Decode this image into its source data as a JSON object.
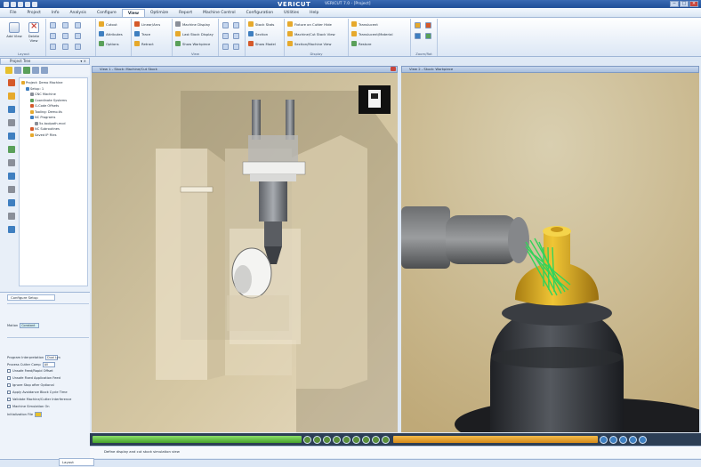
{
  "window": {
    "brand": "VERICUT",
    "document_title": "VERICUT 7.0 - [Project]",
    "quick_access_icons": [
      "new-icon",
      "open-icon",
      "save-icon",
      "undo-icon",
      "redo-icon"
    ],
    "controls": [
      "−",
      "□",
      "×"
    ]
  },
  "menu": {
    "tabs": [
      "File",
      "Project",
      "Info",
      "Analysis",
      "Configure",
      "View",
      "Optimize",
      "Report",
      "Machine Control",
      "Configuration",
      "Utilities",
      "Help"
    ],
    "active_tab": "View"
  },
  "ribbon": {
    "big_buttons": [
      {
        "label": "Add View",
        "icon": "add-view-icon"
      },
      {
        "label": "Delete View",
        "icon": "delete-view-icon"
      }
    ],
    "group_views_label": "Layout",
    "toggles_group": [
      "Cutout",
      "Attributes",
      "Options"
    ],
    "display_group": [
      "Linear/Arcs",
      "Trace",
      "Retract"
    ],
    "machine_group": [
      "Machine Display",
      "Last Stock Display",
      "Show Workpiece"
    ],
    "view_group_label": "View",
    "util_labels": [
      "Stock Stats",
      "Section",
      "Show Model"
    ],
    "clip_group": [
      "Fixture on Cutter Hide",
      "Machine/Cut Stock View",
      "Section/Machine View"
    ],
    "clip_group_label": "Display",
    "trans_group": [
      "Translucent",
      "Translucent/Material",
      "Restore"
    ],
    "trans_group_label": "Zoom/Rot",
    "color_swatches": [
      "#e6a92c",
      "#d55a2b",
      "#3f7fc0",
      "#5aa05a"
    ]
  },
  "left_panel": {
    "title": "Project Tree",
    "tree": [
      {
        "label": "Project: Demo Machine",
        "indent": 0,
        "icon": "project-icon"
      },
      {
        "label": "Setup: 1",
        "indent": 1,
        "icon": "setup-icon"
      },
      {
        "label": "CNC Machine",
        "indent": 2,
        "icon": "machine-icon"
      },
      {
        "label": "Coordinate Systems",
        "indent": 2,
        "icon": "coord-icon"
      },
      {
        "label": "G-Code Offsets",
        "indent": 2,
        "icon": "offset-icon"
      },
      {
        "label": "Tooling: Demo.tls",
        "indent": 2,
        "icon": "tooling-icon"
      },
      {
        "label": "NC Programs",
        "indent": 2,
        "icon": "nc-program-icon"
      },
      {
        "label": "5x-toolpath.mcd",
        "indent": 3,
        "icon": "file-icon"
      },
      {
        "label": "NC Subroutines",
        "indent": 2,
        "icon": "subroutine-icon"
      },
      {
        "label": "Saved IP Files",
        "indent": 2,
        "icon": "saved-icon"
      }
    ],
    "config_tab": "Configure Setup",
    "config_fields": [
      {
        "label": "Motion",
        "value": "Constant"
      }
    ],
    "config_rows": [
      {
        "label": "Program Interpretation",
        "value": "Dual Lyn",
        "type": "select"
      },
      {
        "label": "Process Cutter Comp",
        "value": "All",
        "type": "select"
      },
      {
        "label": "Unsafe Feed/Rapid Offset",
        "value": "",
        "type": "check"
      },
      {
        "label": "Unsafe Fixed Application Feed",
        "value": "",
        "type": "check"
      },
      {
        "label": "Ignore Stop after Optional",
        "value": "",
        "type": "check"
      },
      {
        "label": "Apply Avoidance Block Cycle Time",
        "value": "",
        "type": "check"
      },
      {
        "label": "Validate Machine/Cutter Interference",
        "value": "",
        "type": "check"
      },
      {
        "label": "Machine Simulation On",
        "value": "",
        "type": "check"
      },
      {
        "label": "Initialization File",
        "value": "",
        "type": "file"
      }
    ],
    "bottom_tab": "Layout"
  },
  "viewports": [
    {
      "title": "View 1 - Stock: Machine/Cut Stock",
      "view": "machine"
    },
    {
      "title": "View 2 - Stock: Workpiece",
      "view": "workpiece"
    }
  ],
  "status": {
    "progress_left": 0.32,
    "progress_right": 0.5,
    "message": "Define display and cut stock simulation view"
  },
  "colors": {
    "accent": "#3b6bb3",
    "workpiece_gold": "#d6a51e",
    "toolpath_green": "#33d35a",
    "background_warm": "#c9bb98"
  }
}
